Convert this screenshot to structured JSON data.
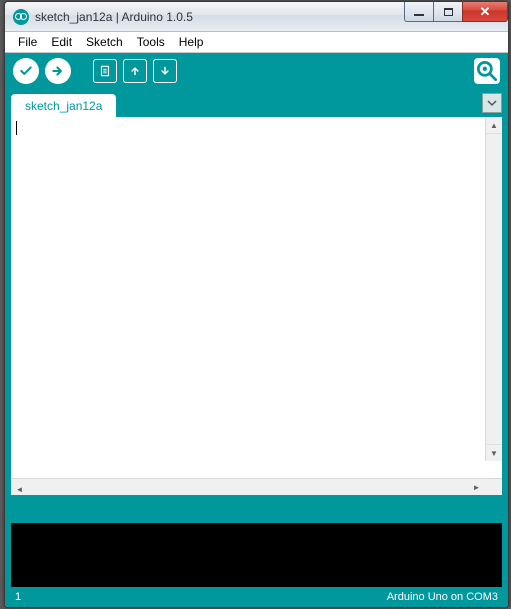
{
  "window": {
    "title": "sketch_jan12a | Arduino 1.0.5"
  },
  "menu": {
    "file": "File",
    "edit": "Edit",
    "sketch": "Sketch",
    "tools": "Tools",
    "help": "Help"
  },
  "tabs": {
    "active": "sketch_jan12a"
  },
  "editor": {
    "content": ""
  },
  "status": {
    "line": "1",
    "board": "Arduino Uno on COM3"
  },
  "icons": {
    "verify": "verify-icon",
    "upload": "upload-icon",
    "new": "new-icon",
    "open": "open-icon",
    "save": "save-icon",
    "serial": "serial-monitor-icon"
  }
}
